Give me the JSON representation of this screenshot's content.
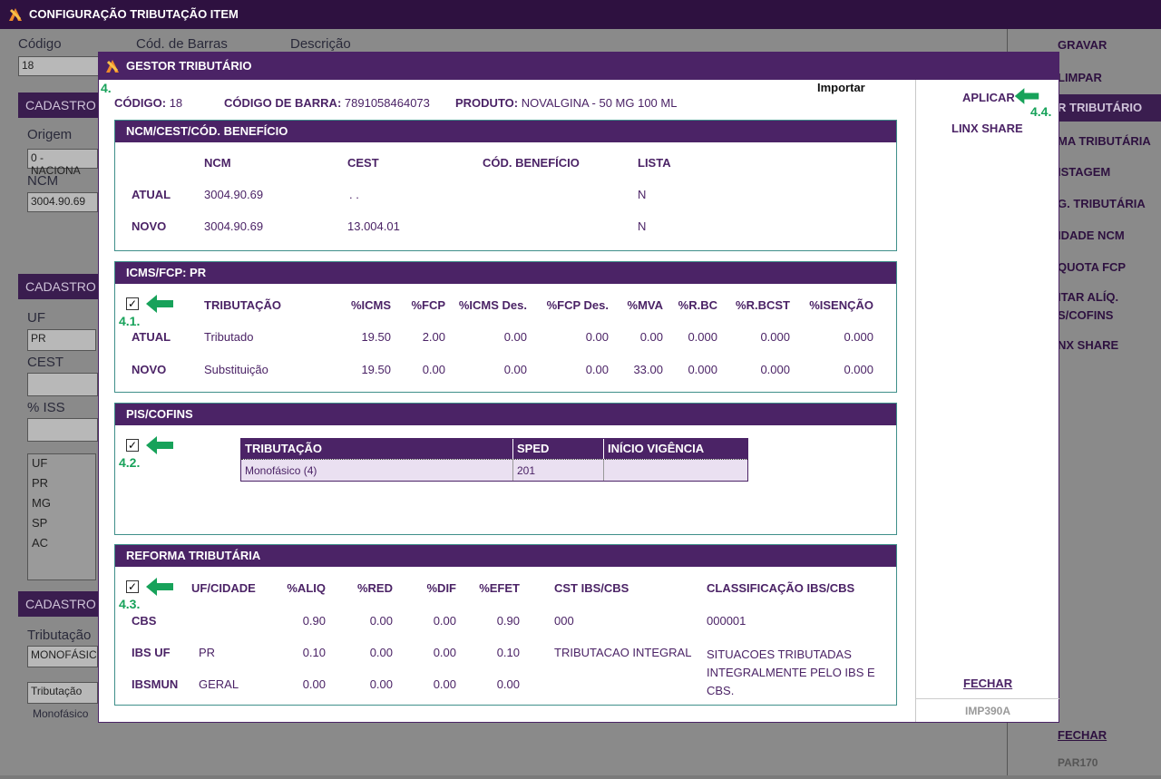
{
  "background": {
    "title": "CONFIGURAÇÃO TRIBUTAÇÃO ITEM",
    "labels": {
      "codigo": "Código",
      "cod_barras": "Cód. de Barras",
      "descricao": "Descrição",
      "origem": "Origem",
      "ncm": "NCM",
      "uf": "UF",
      "cest": "CEST",
      "iss": "% ISS",
      "tributacao": "Tributação"
    },
    "fields": {
      "codigo": "18",
      "origem": "0 - NACIONA",
      "ncm": "3004.90.69",
      "uf": "PR",
      "tributacao": "MONOFÁSIC",
      "trib_col": "Tributação",
      "trib_row": "Monofásico"
    },
    "section_heads": [
      "CADASTRO",
      "CADASTRO",
      "CADASTRO"
    ],
    "uf_list": [
      "UF",
      "PR",
      "MG",
      "SP",
      "AC"
    ],
    "right_buttons": {
      "gravar": "GRAVAR",
      "limpar": "LIMPAR",
      "gestor": "R TRIBUTÁRIO",
      "regra": "MA TRIBUTÁRIA",
      "listagem": "ISTAGEM",
      "config": "G. TRIBUTÁRIA",
      "unidade": "IDADE NCM",
      "quota": "QUOTA FCP",
      "aliq1": "ITAR ALÍQ.",
      "aliq2": "S/COFINS",
      "linx": "NX SHARE",
      "fechar": "FECHAR",
      "code": "PAR170"
    }
  },
  "modal": {
    "title": "GESTOR TRIBUTÁRIO",
    "import": "Importar",
    "step_label": "4.",
    "codigo_label": "CÓDIGO:",
    "codigo": "18",
    "barra_label": "CÓDIGO DE BARRA:",
    "barra": "7891058464073",
    "produto_label": "PRODUTO:",
    "produto": "NOVALGINA - 50 MG 100 ML",
    "right": {
      "aplicar": "APLICAR",
      "linx": "LINX SHARE",
      "fechar": "FECHAR",
      "code": "IMP390A",
      "step": "4.4."
    }
  },
  "ncm": {
    "title": "NCM/CEST/CÓD. BENEFÍCIO",
    "headers": [
      "NCM",
      "CEST",
      "CÓD. BENEFÍCIO",
      "LISTA"
    ],
    "rows": [
      {
        "label": "ATUAL",
        "ncm": "3004.90.69",
        "cest": ". .",
        "beneficio": "",
        "lista": "N"
      },
      {
        "label": "NOVO",
        "ncm": "3004.90.69",
        "cest": "13.004.01",
        "beneficio": "",
        "lista": "N"
      }
    ]
  },
  "icms": {
    "title": "ICMS/FCP: PR",
    "step": "4.1.",
    "checked": "✓",
    "headers": [
      "TRIBUTAÇÃO",
      "%ICMS",
      "%FCP",
      "%ICMS Des.",
      "%FCP Des.",
      "%MVA",
      "%R.BC",
      "%R.BCST",
      "%ISENÇÃO"
    ],
    "rows": [
      {
        "label": "ATUAL",
        "trib": "Tributado",
        "icms": "19.50",
        "fcp": "2.00",
        "icms_des": "0.00",
        "fcp_des": "0.00",
        "mva": "0.00",
        "rbc": "0.000",
        "rbcst": "0.000",
        "isencao": "0.000"
      },
      {
        "label": "NOVO",
        "trib": "Substituição",
        "icms": "19.50",
        "fcp": "0.00",
        "icms_des": "0.00",
        "fcp_des": "0.00",
        "mva": "33.00",
        "rbc": "0.000",
        "rbcst": "0.000",
        "isencao": "0.000"
      }
    ]
  },
  "pis": {
    "title": "PIS/COFINS",
    "step": "4.2.",
    "checked": "✓",
    "headers": [
      "TRIBUTAÇÃO",
      "SPED",
      "INÍCIO VIGÊNCIA"
    ],
    "row": {
      "trib": "Monofásico (4)",
      "sped": "201",
      "inicio": ""
    }
  },
  "reforma": {
    "title": "REFORMA TRIBUTÁRIA",
    "step": "4.3.",
    "checked": "✓",
    "headers": [
      "UF/CIDADE",
      "%ALIQ",
      "%RED",
      "%DIF",
      "%EFET",
      "CST IBS/CBS",
      "CLASSIFICAÇÃO IBS/CBS"
    ],
    "rows": [
      {
        "label": "CBS",
        "uf": "",
        "aliq": "0.90",
        "red": "0.00",
        "dif": "0.00",
        "efet": "0.90",
        "cst": "000",
        "class": "000001"
      },
      {
        "label": "IBS UF",
        "uf": "PR",
        "aliq": "0.10",
        "red": "0.00",
        "dif": "0.00",
        "efet": "0.10",
        "cst": "TRIBUTACAO INTEGRAL",
        "class": "SITUACOES TRIBUTADAS INTEGRALMENTE PELO IBS E CBS."
      },
      {
        "label": "IBSMUN",
        "uf": "GERAL",
        "aliq": "0.00",
        "red": "0.00",
        "dif": "0.00",
        "efet": "0.00",
        "cst": "",
        "class": ""
      }
    ]
  },
  "colors": {
    "purple": "#4b2366",
    "green": "#17a25a",
    "teal": "#3f8f8a"
  }
}
